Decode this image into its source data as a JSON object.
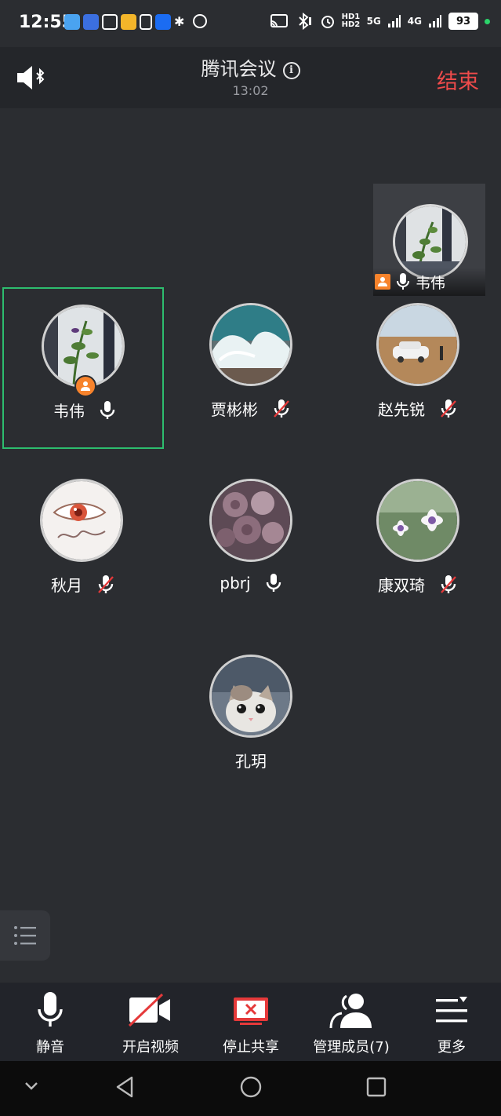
{
  "status_bar": {
    "time": "12:55",
    "network_label": "HD1 HD2",
    "signal_5g": "5G",
    "signal_4g": "4G",
    "battery": "93"
  },
  "header": {
    "title": "腾讯会议",
    "duration": "13:02",
    "end_label": "结束"
  },
  "pip": {
    "name": "韦伟"
  },
  "participants": [
    {
      "name": "韦伟",
      "muted": false,
      "host": true,
      "active": true
    },
    {
      "name": "贾彬彬",
      "muted": true,
      "host": false,
      "active": false
    },
    {
      "name": "赵先锐",
      "muted": true,
      "host": false,
      "active": false
    },
    {
      "name": "秋月",
      "muted": true,
      "host": false,
      "active": false
    },
    {
      "name": "pbrj",
      "muted": false,
      "host": false,
      "active": false
    },
    {
      "name": "康双琦",
      "muted": true,
      "host": false,
      "active": false
    },
    {
      "name": "孔玥",
      "muted": null,
      "host": false,
      "active": false
    }
  ],
  "toolbar": {
    "mute_label": "静音",
    "video_label": "开启视频",
    "share_label": "停止共享",
    "members_label": "管理成员(7)",
    "more_label": "更多"
  },
  "colors": {
    "background": "#2b2d31",
    "end_red": "#ee4b4b",
    "active_border": "#2dbd6e",
    "host_orange": "#f7832c",
    "share_red": "#e5393a"
  }
}
